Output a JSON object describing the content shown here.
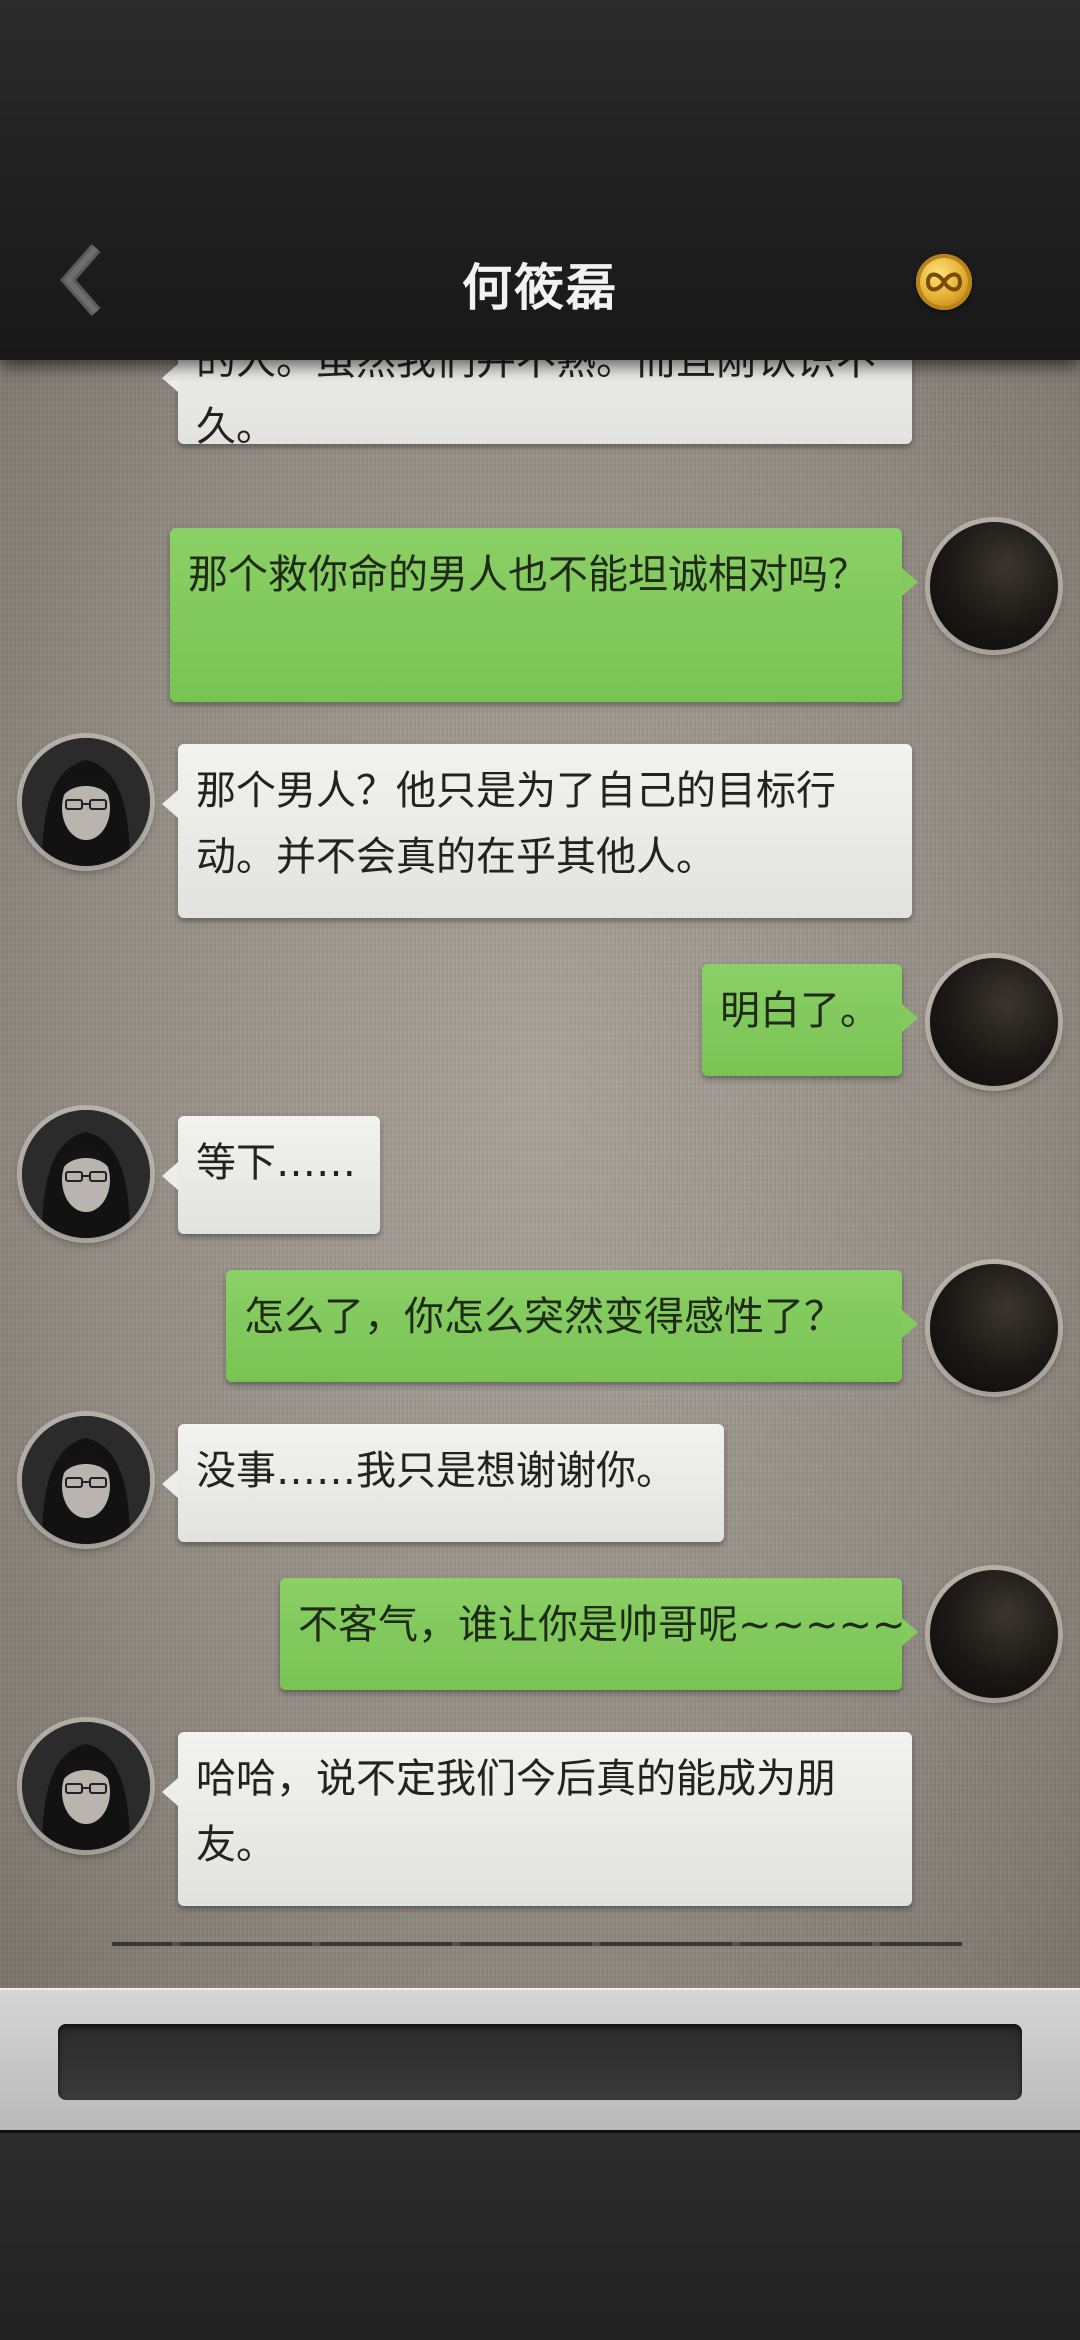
{
  "header": {
    "title": "何筱磊",
    "back_icon": "chevron-left-icon",
    "coin_icon": "infinity-coin-icon"
  },
  "messages": [
    {
      "side": "left",
      "text": "的人。虽然我们并不熟。而且刚认识不久。"
    },
    {
      "side": "right",
      "text": "那个救你命的男人也不能坦诚相对吗？"
    },
    {
      "side": "left",
      "text": "那个男人？他只是为了自己的目标行动。并不会真的在乎其他人。"
    },
    {
      "side": "right",
      "text": "明白了。"
    },
    {
      "side": "left",
      "text": "等下……"
    },
    {
      "side": "right",
      "text": "怎么了，你怎么突然变得感性了？"
    },
    {
      "side": "left",
      "text": "没事……我只是想谢谢你。"
    },
    {
      "side": "right",
      "text": "不客气，谁让你是帅哥呢~~~~~"
    },
    {
      "side": "left",
      "text": "哈哈，说不定我们今后真的能成为朋友。"
    }
  ],
  "input": {
    "value": "",
    "placeholder": ""
  },
  "colors": {
    "left_bubble": "#ecece9",
    "right_bubble": "#84ca5e",
    "header_bg": "#1f1f1f"
  }
}
